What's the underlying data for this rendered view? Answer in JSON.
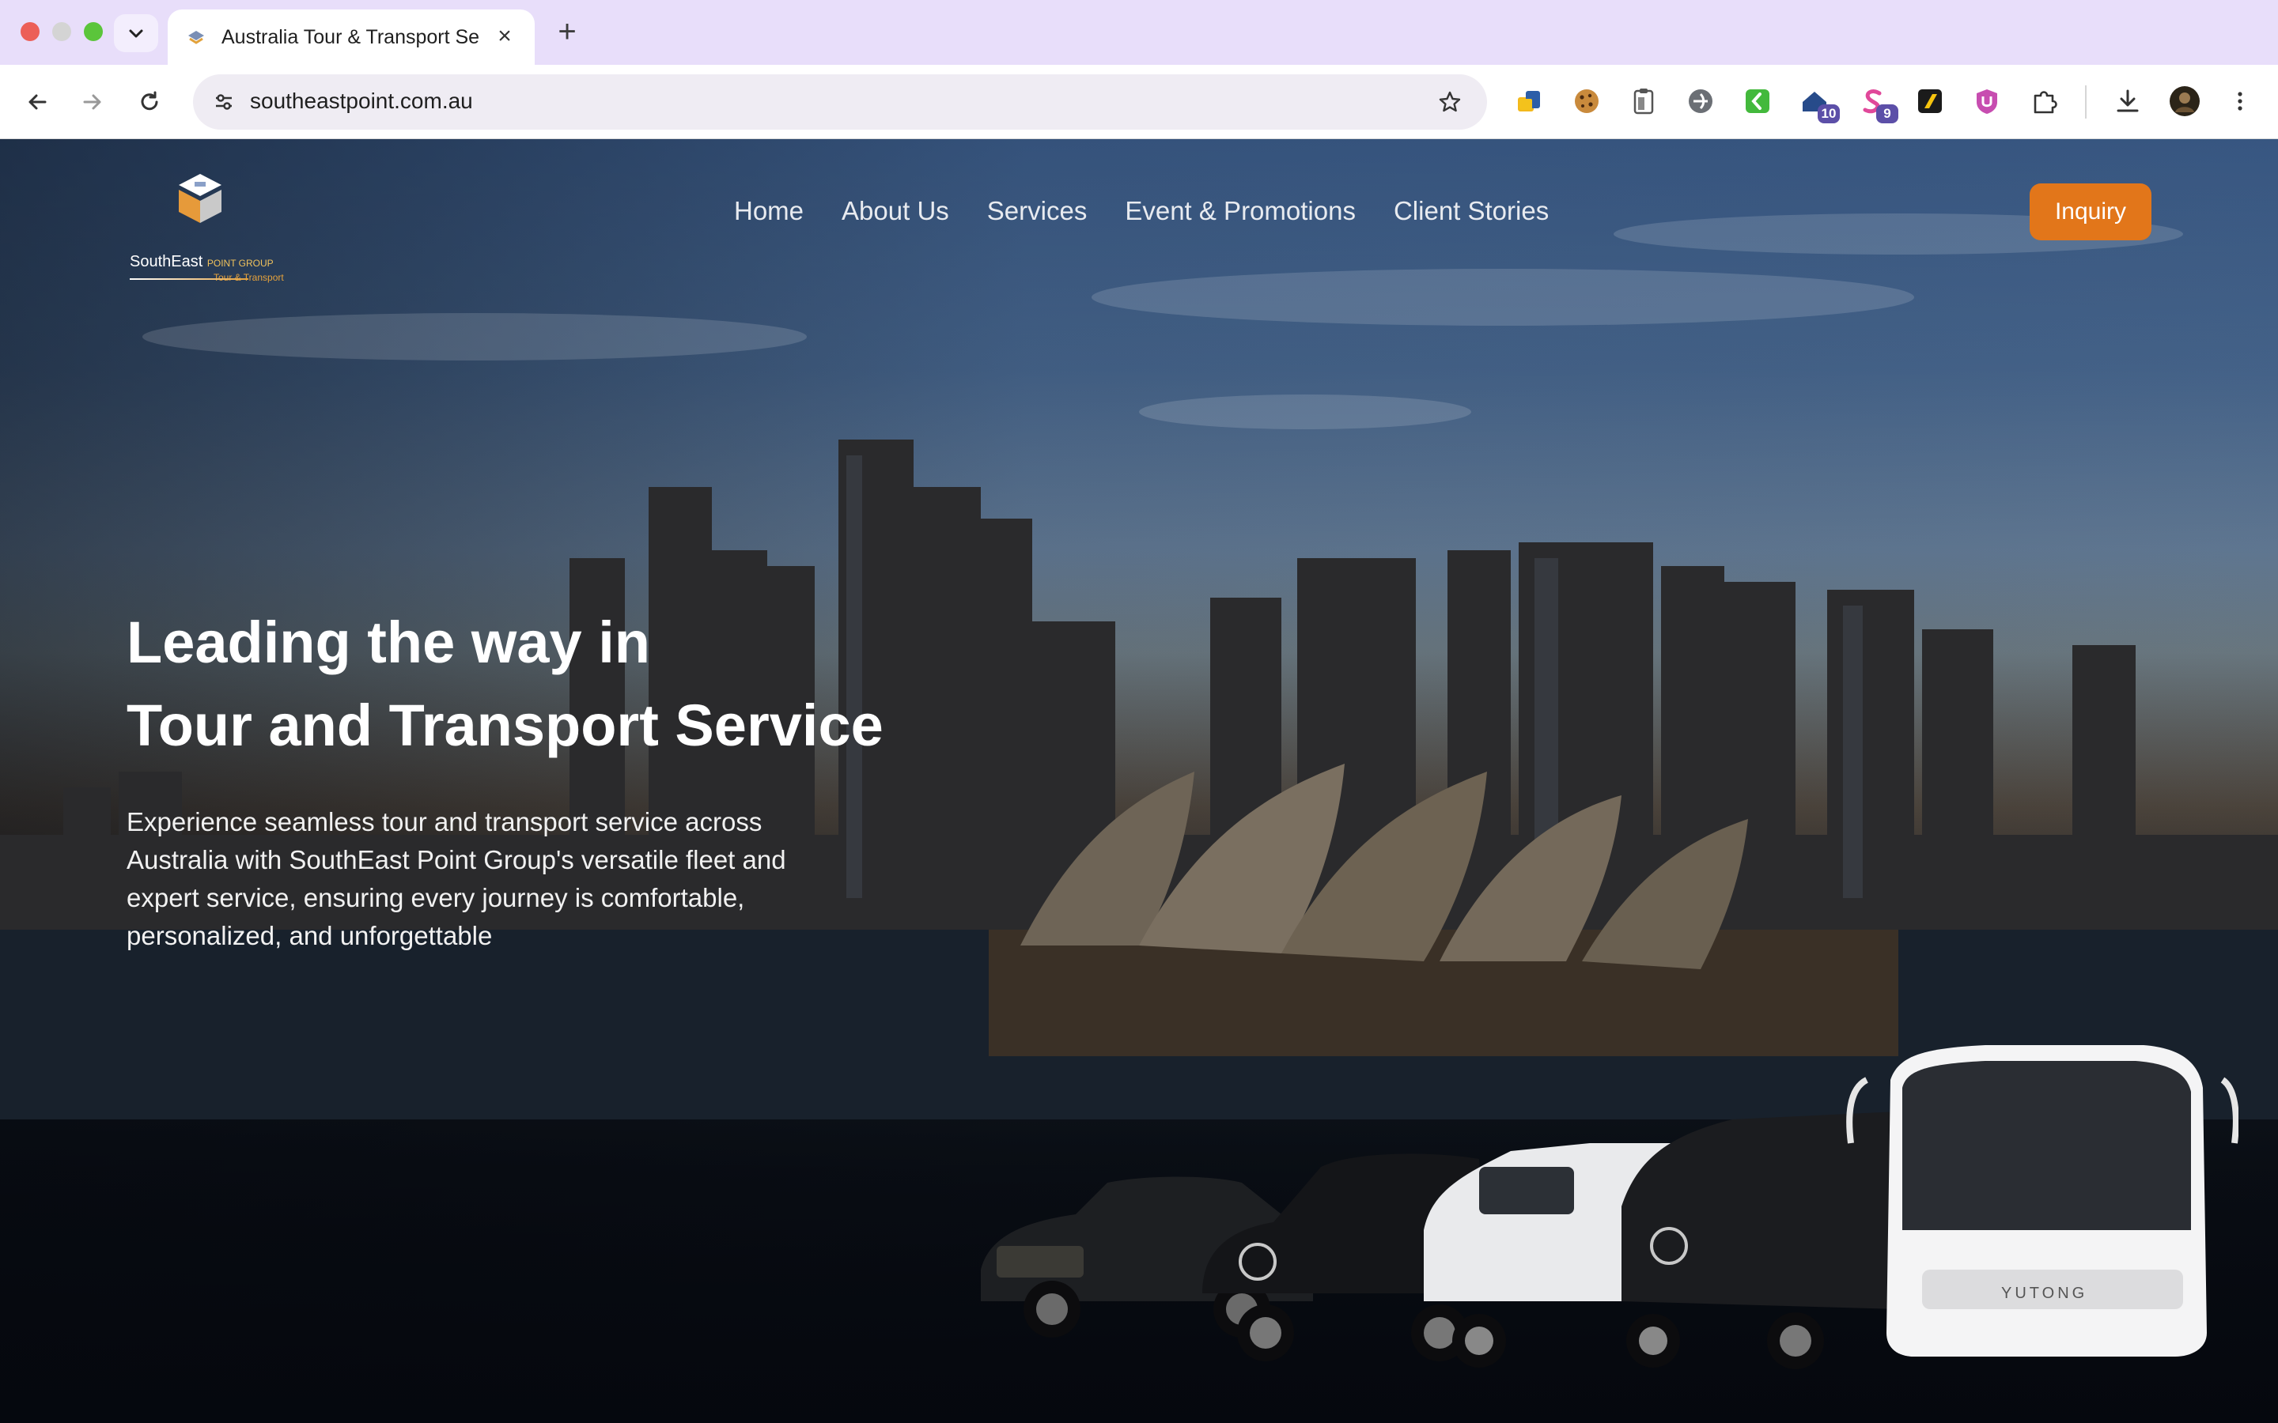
{
  "browser": {
    "tab_title": "Australia Tour & Transport Se",
    "url": "southeastpoint.com.au",
    "extensions": [
      {
        "icon": "puzzle-piece-yellow-icon"
      },
      {
        "icon": "cookie-icon"
      },
      {
        "icon": "clipboard-icon"
      },
      {
        "icon": "shield-circle-icon"
      },
      {
        "icon": "green-k-icon"
      },
      {
        "icon": "home-badge-icon",
        "badge": "10"
      },
      {
        "icon": "pink-s-icon",
        "badge": "9"
      },
      {
        "icon": "yellow-slash-icon"
      },
      {
        "icon": "ublock-icon"
      },
      {
        "icon": "extensions-puzzle-icon"
      }
    ]
  },
  "site": {
    "logo": {
      "brand": "SouthEast",
      "brand_sub": "POINT GROUP",
      "tagline": "Tour & Transport"
    },
    "nav": [
      "Home",
      "About Us",
      "Services",
      "Event & Promotions",
      "Client Stories"
    ],
    "cta": "Inquiry",
    "hero": {
      "title_line1": "Leading the way in",
      "title_line2": "Tour and Transport Service",
      "description": "Experience seamless tour and transport service across Australia with SouthEast Point Group's versatile fleet and expert service, ensuring every journey is comfortable, personalized, and unforgettable",
      "bus_brand": "YUTONG"
    }
  },
  "colors": {
    "tab_strip": "#e8defa",
    "accent": "#e2761a",
    "nav_text": "#e8ebf0"
  }
}
